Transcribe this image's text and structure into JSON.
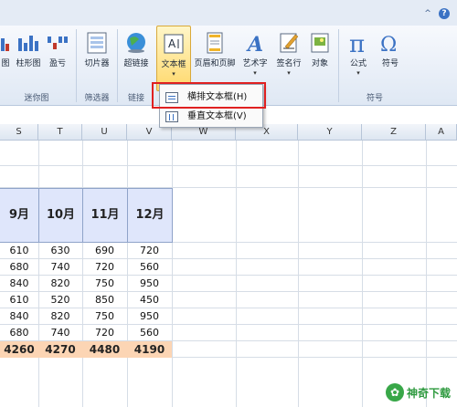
{
  "window": {
    "caret_icon": "^",
    "help_icon": "?"
  },
  "ribbon": {
    "buttons": [
      {
        "label": "图",
        "icon": "sparkline-line-icon"
      },
      {
        "label": "柱形图",
        "icon": "sparkline-column-icon"
      },
      {
        "label": "盈亏",
        "icon": "sparkline-winloss-icon"
      },
      {
        "label": "切片器",
        "icon": "slicer-icon"
      },
      {
        "label": "超链接",
        "icon": "hyperlink-globe-icon"
      },
      {
        "label": "文本框",
        "icon": "textbox-icon",
        "dropdown": "▾"
      },
      {
        "label": "页眉和页脚",
        "icon": "header-footer-icon"
      },
      {
        "label": "艺术字",
        "icon": "wordart-icon",
        "dropdown": "▾"
      },
      {
        "label": "签名行",
        "icon": "signature-line-icon",
        "dropdown": "▾"
      },
      {
        "label": "对象",
        "icon": "object-icon"
      },
      {
        "label": "公式",
        "icon": "equation-pi-icon",
        "dropdown": "▾"
      },
      {
        "label": "符号",
        "icon": "symbol-omega-icon"
      }
    ],
    "groups": {
      "sparklines": "迷你图",
      "filter": "筛选器",
      "links": "链接",
      "symbols": "符号"
    }
  },
  "dropdown": {
    "items": [
      {
        "label": "横排文本框(H)",
        "icon": "horizontal-textbox-icon"
      },
      {
        "label": "垂直文本框(V)",
        "icon": "vertical-textbox-icon"
      }
    ]
  },
  "sheet": {
    "columns": [
      "S",
      "T",
      "U",
      "V",
      "W",
      "X",
      "Y",
      "Z",
      "A"
    ],
    "month_headers": [
      "9月",
      "10月",
      "11月",
      "12月"
    ],
    "rows": [
      [
        "610",
        "630",
        "690",
        "720"
      ],
      [
        "680",
        "740",
        "720",
        "560"
      ],
      [
        "840",
        "820",
        "750",
        "950"
      ],
      [
        "610",
        "520",
        "850",
        "450"
      ],
      [
        "840",
        "820",
        "750",
        "950"
      ],
      [
        "680",
        "740",
        "720",
        "560"
      ]
    ],
    "totals": [
      "4260",
      "4270",
      "4480",
      "4190"
    ]
  },
  "watermark": {
    "logo": "✿",
    "text": "神奇下载"
  }
}
